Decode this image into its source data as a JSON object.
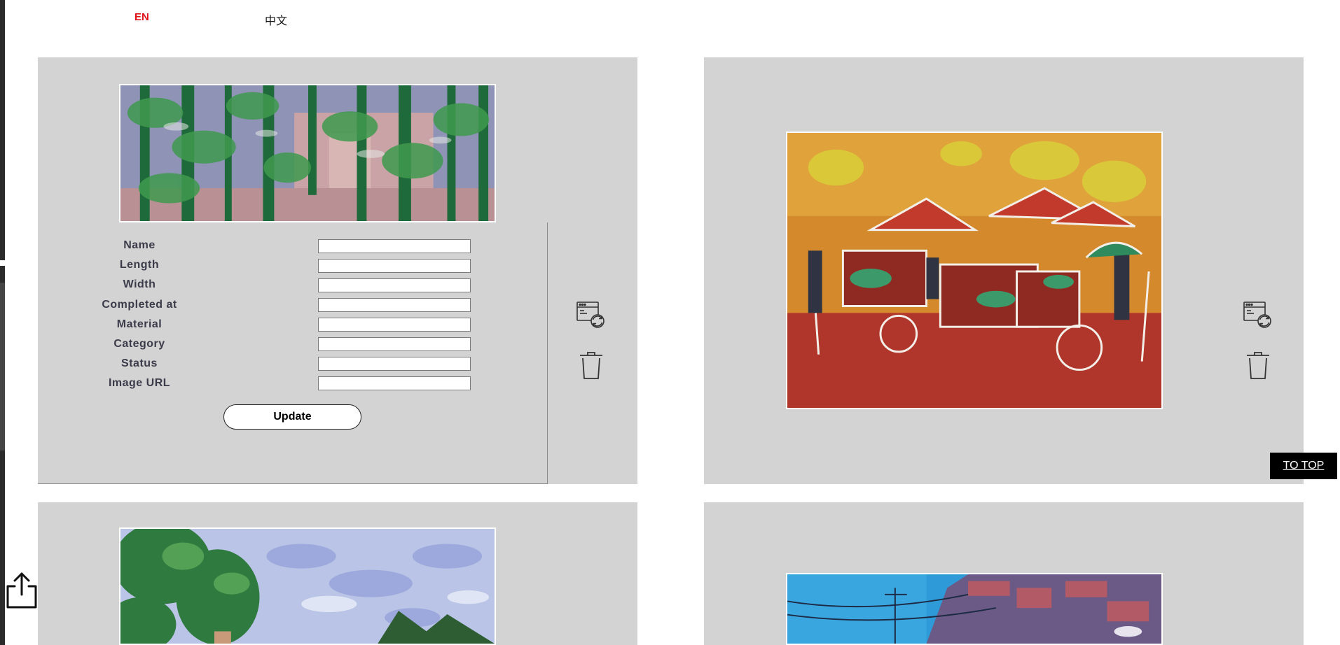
{
  "language": {
    "en_label": "EN",
    "zh_label": "中文"
  },
  "form": {
    "fields": [
      {
        "label": "Name",
        "value": ""
      },
      {
        "label": "Length",
        "value": ""
      },
      {
        "label": "Width",
        "value": ""
      },
      {
        "label": "Completed at",
        "value": ""
      },
      {
        "label": "Material",
        "value": ""
      },
      {
        "label": "Category",
        "value": ""
      },
      {
        "label": "Status",
        "value": ""
      },
      {
        "label": "Image URL",
        "value": ""
      }
    ],
    "update_label": "Update"
  },
  "actions": {
    "edit_icon": "window-refresh-icon",
    "delete_icon": "trash-icon",
    "share_icon": "share-upload-icon"
  },
  "navigation": {
    "to_top_label": "TO TOP"
  },
  "colors": {
    "active_language": "#e0141b",
    "card_background": "#d3d3d3",
    "to_top_background": "#000000"
  }
}
